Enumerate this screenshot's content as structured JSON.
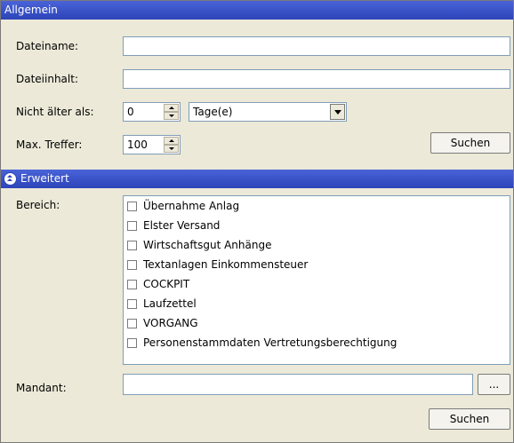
{
  "sections": {
    "general": "Allgemein",
    "extended": "Erweitert"
  },
  "fields": {
    "filename_label": "Dateiname:",
    "filename_value": "",
    "content_label": "Dateiinhalt:",
    "content_value": "",
    "age_label": "Nicht älter als:",
    "age_value": "0",
    "age_unit": "Tage(e)",
    "max_label": "Max. Treffer:",
    "max_value": "100",
    "area_label": "Bereich:",
    "client_label": "Mandant:",
    "client_value": ""
  },
  "buttons": {
    "search": "Suchen",
    "search_extended": "Suchen",
    "browse": "..."
  },
  "areas": [
    "Übernahme Anlag",
    "Elster Versand",
    "Wirtschaftsgut Anhänge",
    "Textanlagen Einkommensteuer",
    "COCKPIT",
    "Laufzettel",
    "VORGANG",
    "Personenstammdaten Vertretungsberechtigung"
  ]
}
